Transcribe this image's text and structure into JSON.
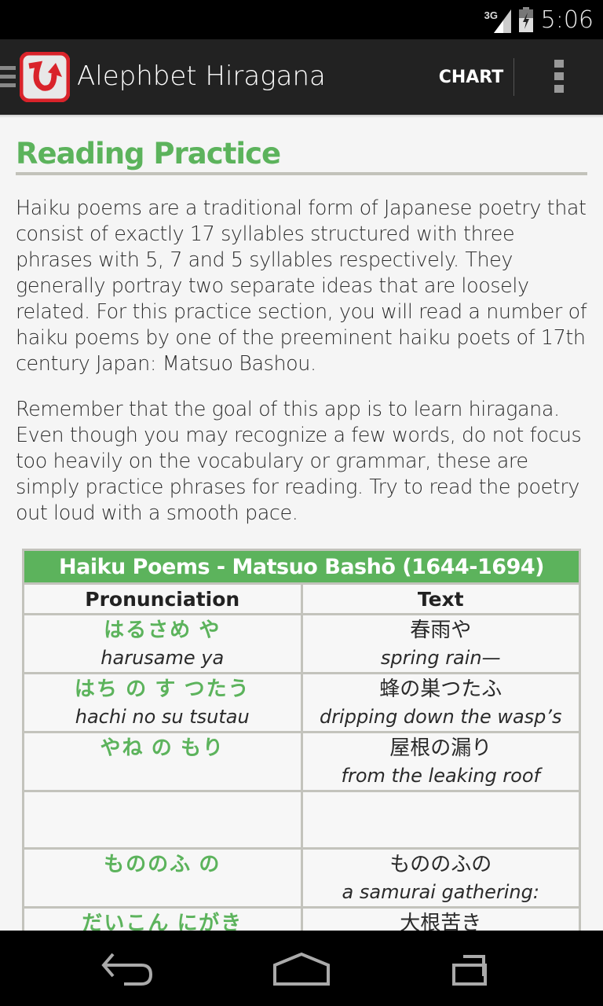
{
  "status_bar": {
    "network": "3G",
    "time": "5:06"
  },
  "action_bar": {
    "title": "Alephbet Hiragana",
    "app_icon_glyph": "ひ",
    "chart_button": "CHART",
    "icons": [
      "hamburger-icon",
      "app-icon",
      "overflow-menu-icon"
    ]
  },
  "content": {
    "heading": "Reading Practice",
    "paragraphs": [
      "Haiku poems are a traditional form of Japanese poetry that consist of exactly 17 syllables structured with three phrases with 5, 7 and 5 syllables respectively.  They generally portray two separate ideas that are loosely related.  For this practice section, you will read a number of haiku poems by one of the preeminent haiku poets of 17th century Japan: Matsuo Bashou.",
      "Remember that the goal of this app is to learn hiragana. Even though you may recognize a few words, do not focus too heavily on the vocabulary or grammar, these are simply practice phrases for reading.  Try to read the poetry out loud with a smooth pace."
    ],
    "table": {
      "title": "Haiku Poems - Matsuo Bashō (1644-1694)",
      "columns": [
        "Pronunciation",
        "Text"
      ],
      "rows": [
        {
          "kana": "はるさめ や",
          "romaji": "harusame ya",
          "text": "春雨や",
          "translation": "spring rain—"
        },
        {
          "kana": "はち の す つたう",
          "romaji": "hachi no su tsutau",
          "text": "蜂の巣つたふ",
          "translation": "dripping down the wasp’s"
        },
        {
          "kana": "やね の もり",
          "romaji": "",
          "text": "屋根の漏り",
          "translation": "from the leaking roof"
        },
        {
          "kana": "",
          "romaji": "",
          "text": "",
          "translation": ""
        },
        {
          "kana": "もののふ の",
          "romaji": "",
          "text": "もののふの",
          "translation": "a samurai gathering:"
        },
        {
          "kana": "だいこん にがき",
          "romaji": "",
          "text": "大根苦き",
          "translation": ""
        }
      ]
    }
  },
  "nav_bar": {
    "buttons": [
      "back",
      "home",
      "recents"
    ]
  }
}
